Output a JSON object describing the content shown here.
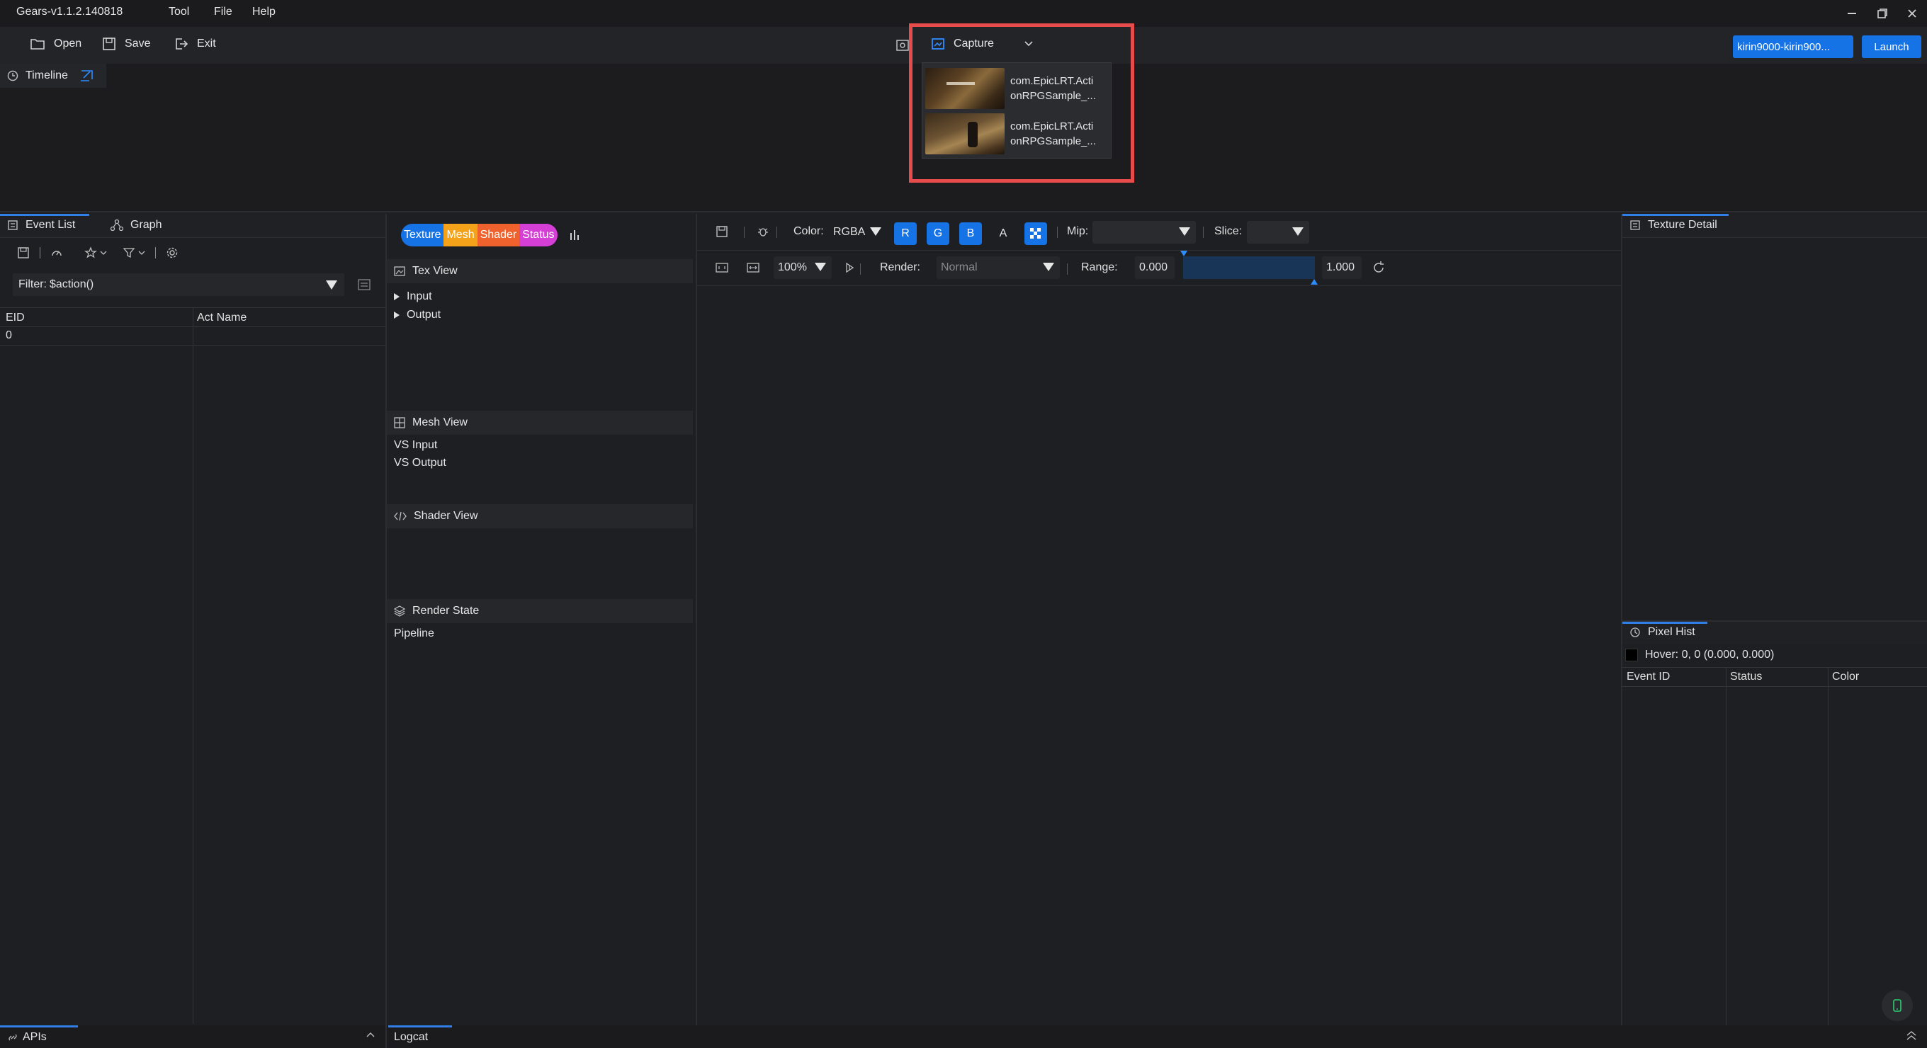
{
  "app": {
    "title": "Gears-v1.1.2.140818"
  },
  "menu": [
    "Tool",
    "File",
    "Help"
  ],
  "toolbar": {
    "open": "Open",
    "save": "Save",
    "exit": "Exit",
    "capture": "Capture",
    "device": "kirin9000-kirin900...",
    "launch": "Launch"
  },
  "timeline": {
    "label": "Timeline"
  },
  "capture_menu": {
    "items": [
      {
        "name": "com.EpicLRT.ActionRPGSample_...",
        "line1": "com.EpicLRT.Acti",
        "line2": "onRPGSample_..."
      },
      {
        "name": "com.EpicLRT.ActionRPGSample_...",
        "line1": "com.EpicLRT.Acti",
        "line2": "onRPGSample_..."
      }
    ]
  },
  "left_panel": {
    "tabs": [
      "Event List",
      "Graph"
    ],
    "filter_label": "Filter:",
    "filter_value": "$action()",
    "columns": [
      "EID",
      "Act Name"
    ],
    "rows": [
      {
        "eid": "0",
        "act": ""
      }
    ]
  },
  "mid_panel": {
    "pills": [
      {
        "label": "Texture",
        "color": "#1673e6"
      },
      {
        "label": "Mesh",
        "color": "#f5a21b"
      },
      {
        "label": "Shader",
        "color": "#f0622d"
      },
      {
        "label": "Status",
        "color": "#d63fd6"
      }
    ],
    "tex_view": {
      "title": "Tex View",
      "items": [
        "Input",
        "Output"
      ]
    },
    "mesh_view": {
      "title": "Mesh View",
      "items": [
        "VS Input",
        "VS Output"
      ]
    },
    "shader_view": {
      "title": "Shader View"
    },
    "render_state": {
      "title": "Render State",
      "items": [
        "Pipeline"
      ]
    }
  },
  "viewer": {
    "color_label": "Color:",
    "color_value": "RGBA",
    "channels": [
      "R",
      "G",
      "B",
      "A"
    ],
    "mip_label": "Mip:",
    "mip_value": "",
    "slice_label": "Slice:",
    "slice_value": "",
    "zoom": "100%",
    "render_label": "Render:",
    "render_value": "Normal",
    "range_label": "Range:",
    "range_min": "0.000",
    "range_max": "1.000"
  },
  "right_panel": {
    "texture_detail": "Texture Detail",
    "pixel_hist": "Pixel Hist",
    "hover": "Hover: 0, 0 (0.000, 0.000)",
    "columns": [
      "Event ID",
      "Status",
      "Color"
    ]
  },
  "bottom": {
    "apis": "APIs",
    "logcat": "Logcat"
  },
  "colors": {
    "accent": "#1673e6",
    "highlight": "#e74c4c"
  }
}
